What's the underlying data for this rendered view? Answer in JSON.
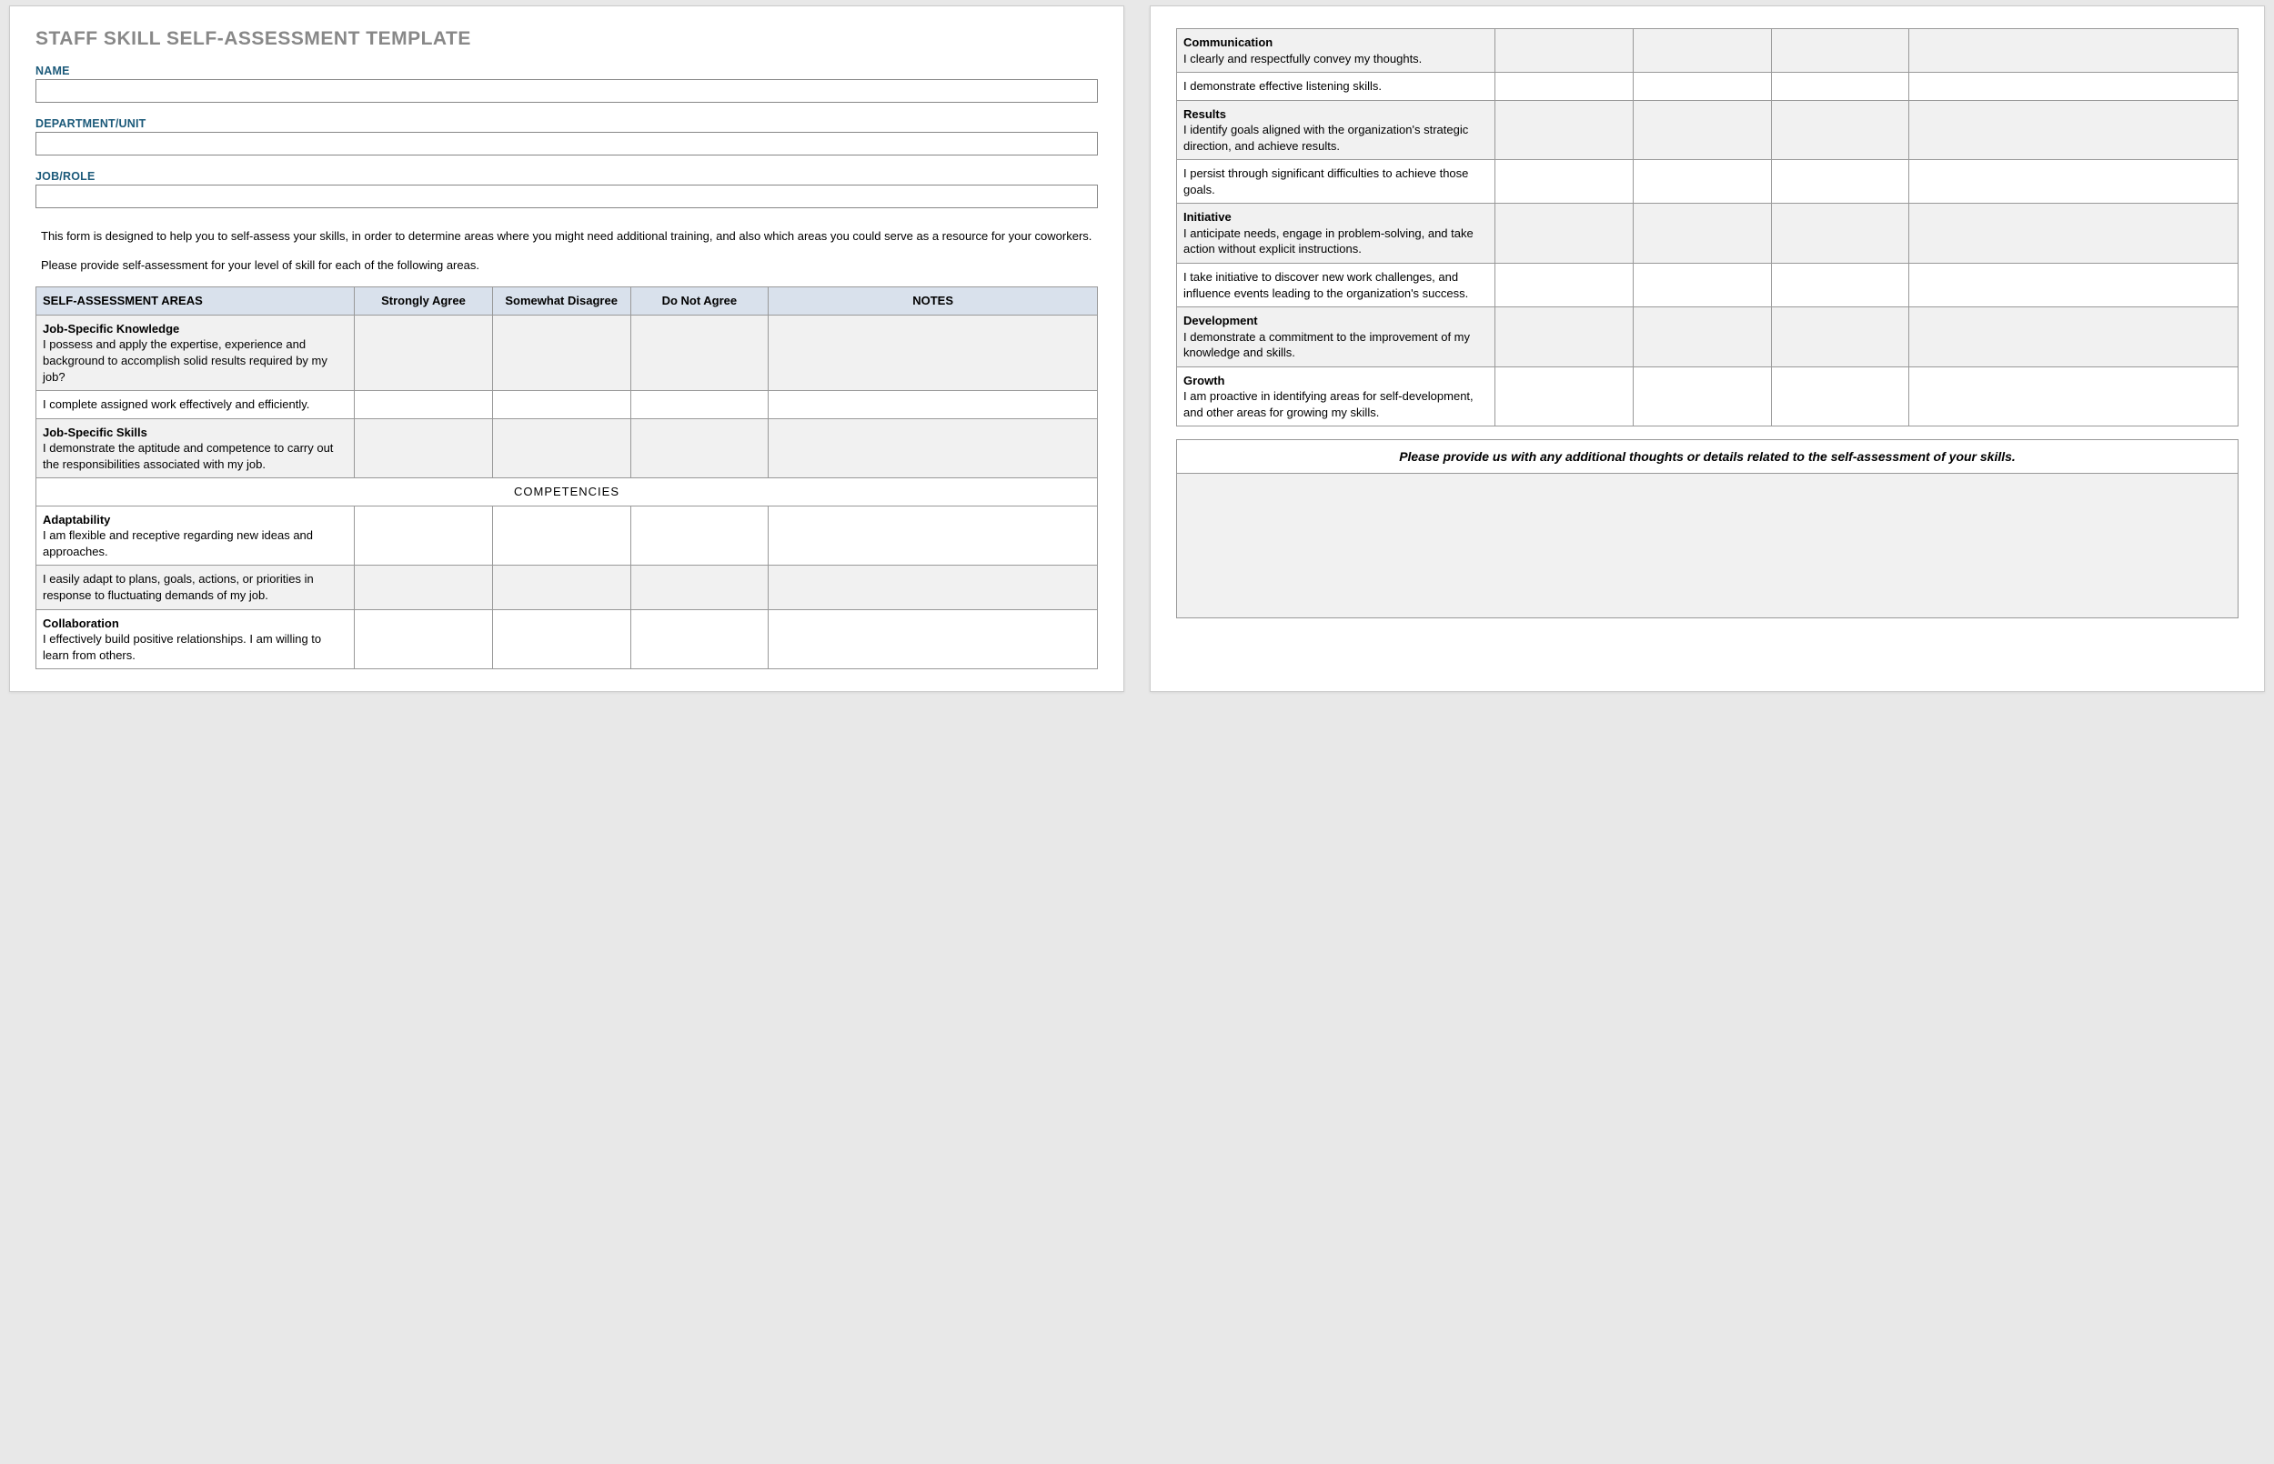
{
  "title": "STAFF SKILL SELF-ASSESSMENT TEMPLATE",
  "fields": {
    "name_label": "NAME",
    "department_label": "DEPARTMENT/UNIT",
    "job_label": "JOB/ROLE",
    "name_value": "",
    "department_value": "",
    "job_value": ""
  },
  "intro": {
    "p1": "This form is designed to help you to self-assess your skills, in order to determine areas where you might need additional training, and also which areas you could serve as a resource for your coworkers.",
    "p2": "Please provide self-assessment for your level of skill for each of the following areas."
  },
  "headers": {
    "areas": "SELF-ASSESSMENT AREAS",
    "strongly": "Strongly Agree",
    "somewhat": "Somewhat Disagree",
    "donot": "Do Not Agree",
    "notes": "NOTES"
  },
  "section_label": "COMPETENCIES",
  "rows1": [
    {
      "title": "Job-Specific Knowledge",
      "text": "I possess and apply the expertise, experience and background to accomplish solid results required by my job?",
      "shade": true
    },
    {
      "title": "",
      "text": "I complete assigned work effectively and efficiently.",
      "shade": false
    },
    {
      "title": "Job-Specific Skills",
      "text": "I demonstrate the aptitude and competence to carry out the responsibilities associated with my job.",
      "shade": true
    }
  ],
  "rows2": [
    {
      "title": "Adaptability",
      "text": "I am flexible and receptive regarding new ideas and approaches.",
      "shade": false
    },
    {
      "title": "",
      "text": "I easily adapt to plans, goals, actions, or priorities in response to fluctuating demands of my job.",
      "shade": true
    },
    {
      "title": "Collaboration",
      "text": "I effectively build positive relationships. I am willing to learn from others.",
      "shade": false
    }
  ],
  "rows3": [
    {
      "title": "Communication",
      "text": "I clearly and respectfully convey my thoughts.",
      "shade": true
    },
    {
      "title": "",
      "text": "I demonstrate effective listening skills.",
      "shade": false
    },
    {
      "title": "Results",
      "text": "I identify goals aligned with the organization's strategic direction, and achieve results.",
      "shade": true
    },
    {
      "title": "",
      "text": "I persist through significant difficulties to achieve those goals.",
      "shade": false
    },
    {
      "title": "Initiative",
      "text": "I anticipate needs, engage in problem-solving, and take action without explicit instructions.",
      "shade": true
    },
    {
      "title": "",
      "text": "I take initiative to discover new work challenges, and influence events leading to the organization's success.",
      "shade": false
    },
    {
      "title": "Development",
      "text": "I demonstrate a commitment to the improvement of my knowledge and skills.",
      "shade": true
    },
    {
      "title": "Growth",
      "text": "I am proactive in identifying areas for self-development, and other areas for growing my skills.",
      "shade": false
    }
  ],
  "additional": {
    "label": "Please provide us with any additional thoughts or details related to the self-assessment of your skills.",
    "value": ""
  }
}
